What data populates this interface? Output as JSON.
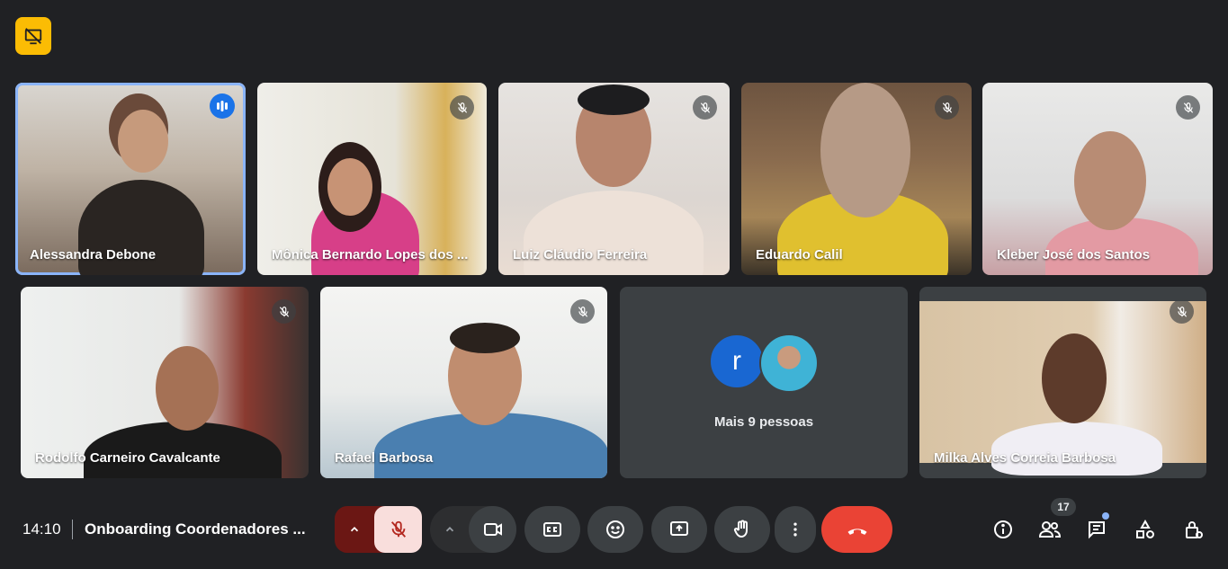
{
  "meeting": {
    "time": "14:10",
    "title": "Onboarding Coordenadores ..."
  },
  "participants": [
    {
      "name": "Alessandra Debone",
      "status": "speaking"
    },
    {
      "name": "Mônica Bernardo Lopes dos ...",
      "status": "muted"
    },
    {
      "name": "Luiz Cláudio Ferreira",
      "status": "muted"
    },
    {
      "name": "Eduardo Calil",
      "status": "muted"
    },
    {
      "name": "Kleber José dos Santos",
      "status": "muted"
    },
    {
      "name": "Rodolfo Carneiro Cavalcante",
      "status": "muted"
    },
    {
      "name": "Rafael Barbosa",
      "status": "muted"
    },
    {
      "name": "Milka Alves Correia Barbosa",
      "status": "muted"
    }
  ],
  "overflow": {
    "avatar_letter": "r",
    "label": "Mais 9 pessoas"
  },
  "people_count": "17",
  "colors": {
    "accent": "#8ab4f8",
    "end_call": "#ea4335",
    "badge": "#fbbc04",
    "mic_off_bg": "#f9dedc"
  },
  "icons": {
    "top": "presentation-off-icon",
    "controls": [
      "chevron-up-icon",
      "mic-off-icon",
      "chevron-up-icon",
      "camera-icon",
      "captions-icon",
      "emoji-icon",
      "present-icon",
      "raise-hand-icon",
      "more-vert-icon",
      "call-end-icon"
    ],
    "right": [
      "info-icon",
      "people-icon",
      "chat-icon",
      "activities-icon",
      "host-controls-icon"
    ]
  }
}
